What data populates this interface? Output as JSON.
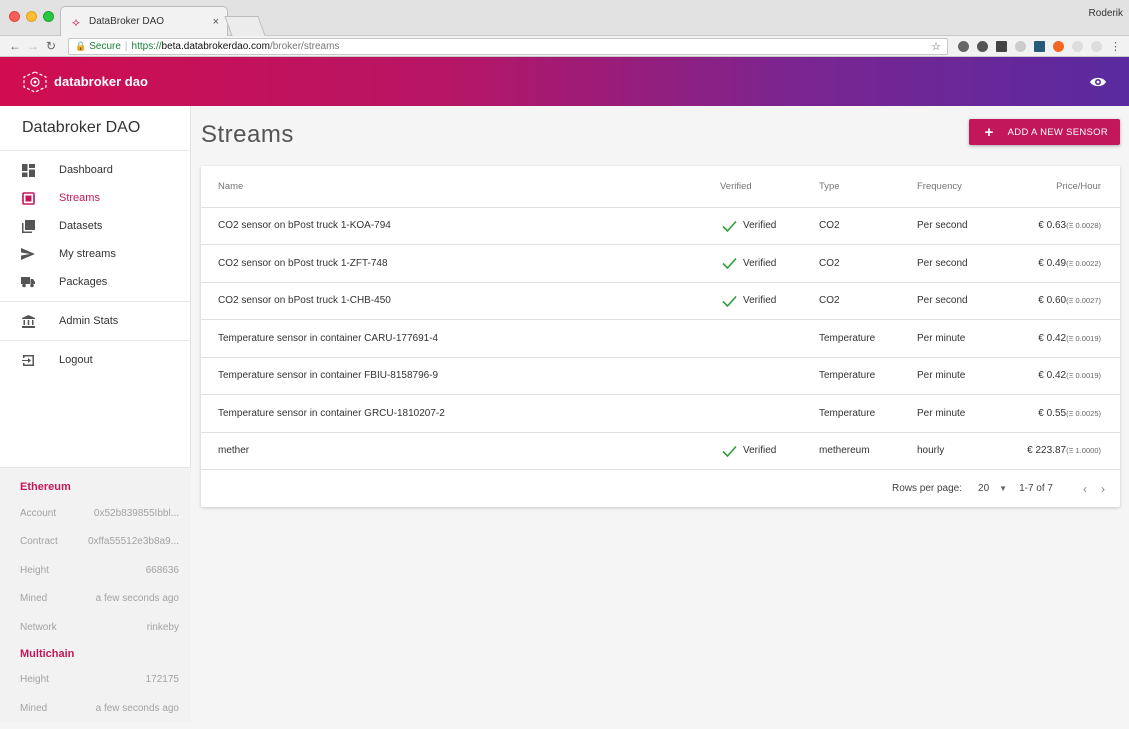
{
  "browser": {
    "tab_title": "DataBroker DAO",
    "tab_close": "×",
    "profile": "Roderik",
    "secure_label": "Secure",
    "url_scheme": "https://",
    "url_host": "beta.databrokerdao.com",
    "url_path": "/broker/streams"
  },
  "header": {
    "logo_text": "databroker dao"
  },
  "sidebar": {
    "brand": "Databroker DAO",
    "items": [
      {
        "label": "Dashboard"
      },
      {
        "label": "Streams"
      },
      {
        "label": "Datasets"
      },
      {
        "label": "My streams"
      },
      {
        "label": "Packages"
      },
      {
        "label": "Admin Stats"
      },
      {
        "label": "Logout"
      }
    ],
    "ethereum": {
      "title": "Ethereum",
      "rows": [
        {
          "label": "Account",
          "value": "0x52b839855Ibbl..."
        },
        {
          "label": "Contract",
          "value": "0xffa55512e3b8a9..."
        },
        {
          "label": "Height",
          "value": "668636"
        },
        {
          "label": "Mined",
          "value": "a few seconds ago"
        },
        {
          "label": "Network",
          "value": "rinkeby"
        }
      ]
    },
    "multichain": {
      "title": "Multichain",
      "rows": [
        {
          "label": "Height",
          "value": "172175"
        },
        {
          "label": "Mined",
          "value": "a few seconds ago"
        }
      ]
    }
  },
  "main": {
    "title": "Streams",
    "add_button": "ADD A NEW SENSOR",
    "columns": [
      "Name",
      "Verified",
      "Type",
      "Frequency",
      "Price/Hour"
    ],
    "rows": [
      {
        "name": "CO2 sensor on bPost truck 1-KOA-794",
        "verified": "Verified",
        "type": "CO2",
        "frequency": "Per second",
        "price": "€ 0.63",
        "eth": "(Ξ 0.0028)"
      },
      {
        "name": "CO2 sensor on bPost truck 1-ZFT-748",
        "verified": "Verified",
        "type": "CO2",
        "frequency": "Per second",
        "price": "€ 0.49",
        "eth": "(Ξ 0.0022)"
      },
      {
        "name": "CO2 sensor on bPost truck 1-CHB-450",
        "verified": "Verified",
        "type": "CO2",
        "frequency": "Per second",
        "price": "€ 0.60",
        "eth": "(Ξ 0.0027)"
      },
      {
        "name": "Temperature sensor in container CARU-177691-4",
        "verified": "",
        "type": "Temperature",
        "frequency": "Per minute",
        "price": "€ 0.42",
        "eth": "(Ξ 0.0019)"
      },
      {
        "name": "Temperature sensor in container FBIU-8158796-9",
        "verified": "",
        "type": "Temperature",
        "frequency": "Per minute",
        "price": "€ 0.42",
        "eth": "(Ξ 0.0019)"
      },
      {
        "name": "Temperature sensor in container GRCU-1810207-2",
        "verified": "",
        "type": "Temperature",
        "frequency": "Per minute",
        "price": "€ 0.55",
        "eth": "(Ξ 0.0025)"
      },
      {
        "name": "mether",
        "verified": "Verified",
        "type": "methereum",
        "frequency": "hourly",
        "price": "€ 223.87",
        "eth": "(Ξ 1.0000)"
      }
    ],
    "pager": {
      "rows_per_page_label": "Rows per page:",
      "rows_per_page": "20",
      "range": "1-7 of 7"
    }
  }
}
